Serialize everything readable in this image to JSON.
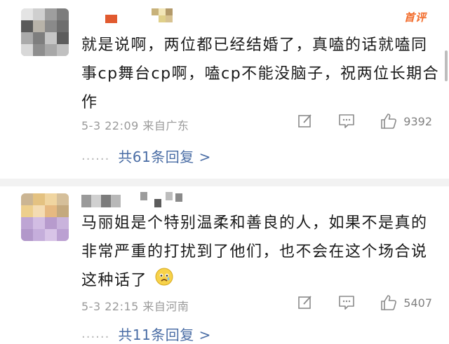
{
  "comments": [
    {
      "badge": "首评",
      "text": "就是说啊，两位都已经结婚了，真嗑的话就嗑同事cp舞台cp啊，嗑cp不能没脑子，祝两位长期合作",
      "meta": "5-3 22:09  来自广东",
      "likes": "9392",
      "replies": "共61条回复 >",
      "more_dots": "......"
    },
    {
      "text": "马丽姐是个特别温柔和善良的人，如果不是真的非常严重的打扰到了他们，也不会在这个场合说这种话了",
      "meta": "5-3 22:15  来自河南",
      "likes": "5407",
      "replies": "共11条回复 >",
      "more_dots": "......"
    }
  ],
  "colors": {
    "accent_link": "#4a6da5",
    "badge": "#f26b2a",
    "meta": "#9a9a9a"
  },
  "icons": [
    "edit-icon",
    "comment-icon",
    "like-icon",
    "sad-emoji-icon"
  ]
}
